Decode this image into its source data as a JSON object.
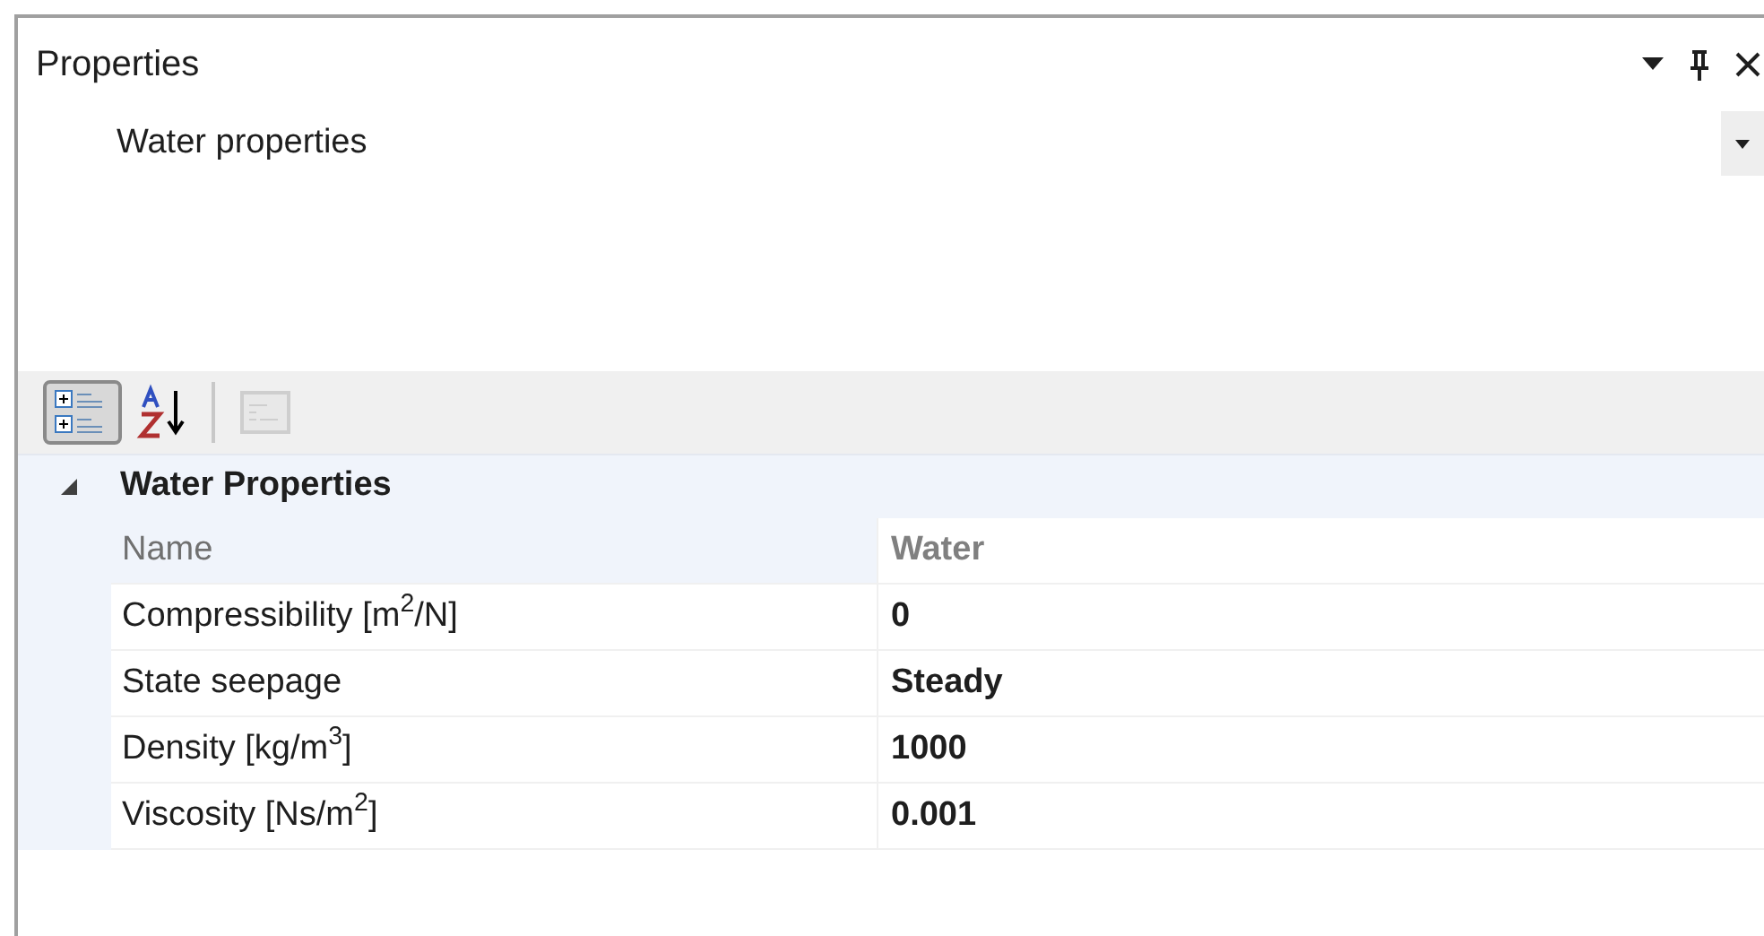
{
  "panel": {
    "title": "Properties"
  },
  "object_selector": {
    "value": "Water properties"
  },
  "toolbar": {
    "categorized": {
      "selected": true
    },
    "alphabetical": {
      "selected": false
    },
    "property_pages": {
      "disabled": true
    }
  },
  "grid": {
    "categories": [
      {
        "label": "Water Properties",
        "expanded": true,
        "rows": [
          {
            "name": "Name",
            "value": "Water",
            "readonly": true
          },
          {
            "name": "Compressibility [m$^{2}$/N]",
            "value": "0",
            "readonly": false
          },
          {
            "name": "State seepage",
            "value": "Steady",
            "readonly": false
          },
          {
            "name": "Density [kg/m$^{3}$]",
            "value": "1000",
            "readonly": false
          },
          {
            "name": "Viscosity [Ns/m$^{2}$]",
            "value": "0.001",
            "readonly": false
          }
        ]
      }
    ]
  }
}
